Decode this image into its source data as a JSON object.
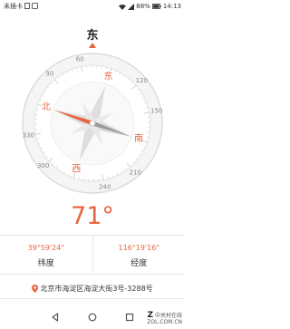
{
  "status_bar": {
    "carrier": "未插卡",
    "battery": "88%",
    "time": "14:13"
  },
  "heading_direction": "东",
  "compass": {
    "cardinals": {
      "north": "北",
      "east": "东",
      "south": "南",
      "west": "西"
    },
    "degree_labels": [
      "30",
      "60",
      "120",
      "150",
      "210",
      "240",
      "300",
      "330"
    ],
    "needle_colors": {
      "north": "#e8663f",
      "south": "#9a9a9a"
    }
  },
  "heading_degrees": "71°",
  "coordinates": {
    "latitude_value": "39°59'24\"",
    "latitude_label": "纬度",
    "longitude_value": "116°19'16\"",
    "longitude_label": "经度"
  },
  "address": "北京市海淀区海淀大街3号-3288号",
  "colors": {
    "accent": "#e8663f"
  },
  "watermark": {
    "site": "中关村在线",
    "domain": "ZOL.COM.CN"
  }
}
